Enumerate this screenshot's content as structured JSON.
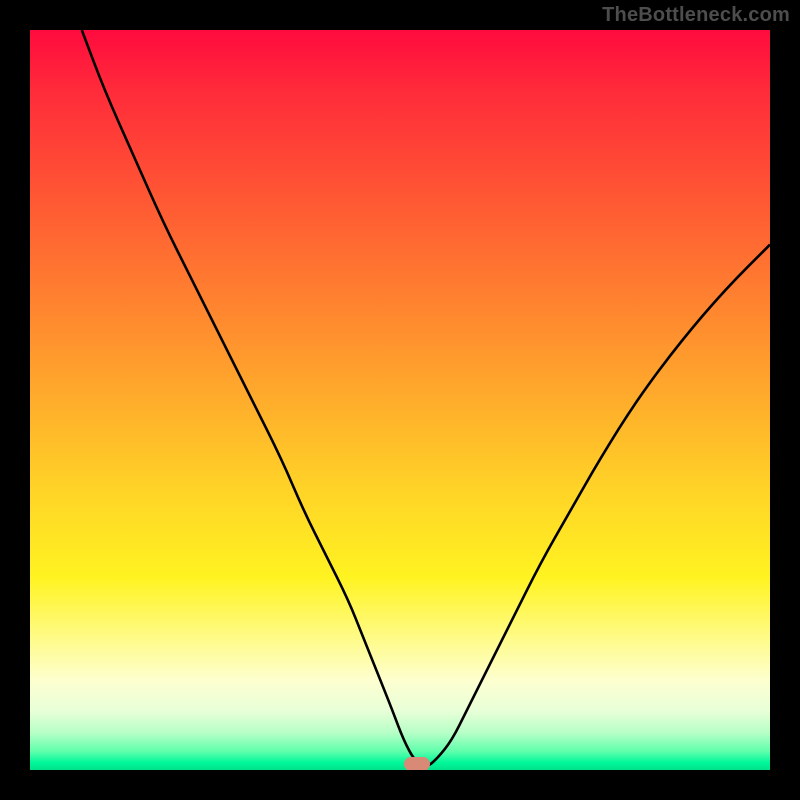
{
  "credit": "TheBottleneck.com",
  "marker": {
    "x_pct": 52.3,
    "y_pct": 99.2,
    "color": "#d88a76"
  },
  "chart_data": {
    "type": "line",
    "title": "",
    "xlabel": "",
    "ylabel": "",
    "xlim": [
      0,
      100
    ],
    "ylim": [
      0,
      100
    ],
    "series": [
      {
        "name": "curve",
        "x": [
          7,
          10,
          14,
          18,
          22,
          26,
          30,
          34,
          37,
          40,
          43,
          45,
          47,
          49,
          50.5,
          52,
          53.5,
          55,
          57,
          59,
          62,
          65,
          69,
          73,
          77,
          82,
          88,
          94,
          100
        ],
        "y": [
          100,
          92,
          83,
          74,
          66,
          58,
          50,
          42,
          35,
          29,
          23,
          18,
          13,
          8,
          4,
          1.2,
          0.3,
          1.5,
          4,
          8,
          14,
          20,
          28,
          35,
          42,
          50,
          58,
          65,
          71
        ]
      }
    ],
    "annotations": [
      {
        "text": "TheBottleneck.com",
        "pos": "top-right"
      }
    ],
    "gradient_stops": [
      {
        "pct": 0,
        "color": "#ff0b3e"
      },
      {
        "pct": 34,
        "color": "#ff7a30"
      },
      {
        "pct": 62,
        "color": "#ffd327"
      },
      {
        "pct": 88,
        "color": "#fdffd0"
      },
      {
        "pct": 100,
        "color": "#00e28a"
      }
    ]
  }
}
